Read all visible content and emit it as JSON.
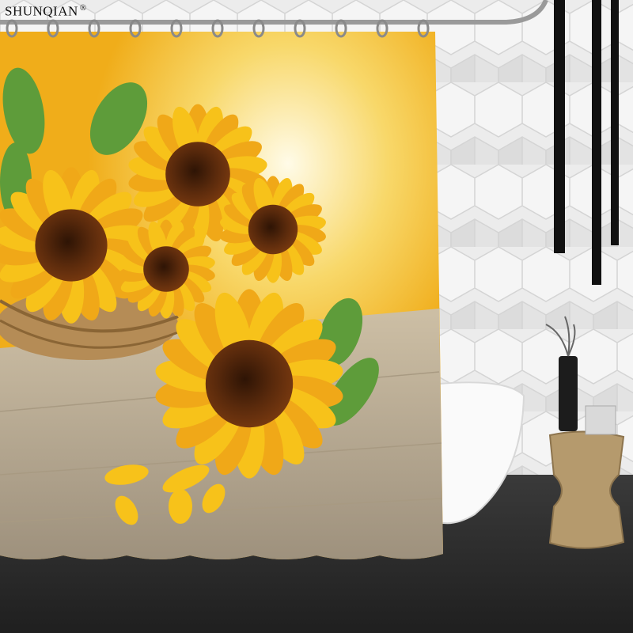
{
  "brand": {
    "name": "SHUNQIAN",
    "mark": "®"
  },
  "scene": {
    "subject": "sunflower-shower-curtain",
    "colors": {
      "wall": "#e9e9e9",
      "floor": "#2a2a2a",
      "curtain_bg": "#f2b21e",
      "petal": "#f7c21a",
      "center": "#5a2a0c",
      "leaf": "#5e9c3a",
      "table": "#b8a991"
    }
  }
}
